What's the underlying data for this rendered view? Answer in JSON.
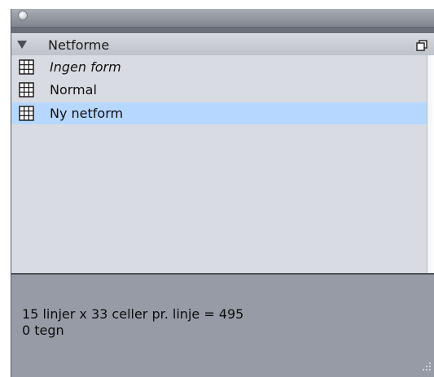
{
  "panel": {
    "section_title": "Netforme"
  },
  "list": {
    "items": [
      {
        "label": "Ingen form",
        "italic": true,
        "selected": false
      },
      {
        "label": "Normal",
        "italic": false,
        "selected": false
      },
      {
        "label": "Ny netform",
        "italic": false,
        "selected": true
      }
    ]
  },
  "info": {
    "line1": "15 linjer x 33 celler pr. linje = 495",
    "line2": "0 tegn"
  },
  "icons": {
    "collapse": "disclosure-triangle-icon",
    "header_action": "copy-window-icon",
    "item": "grid-table-icon"
  },
  "colors": {
    "selection": "#b6d7ff",
    "list_bg": "#d8dbe1",
    "info_bg": "#969ba6"
  }
}
